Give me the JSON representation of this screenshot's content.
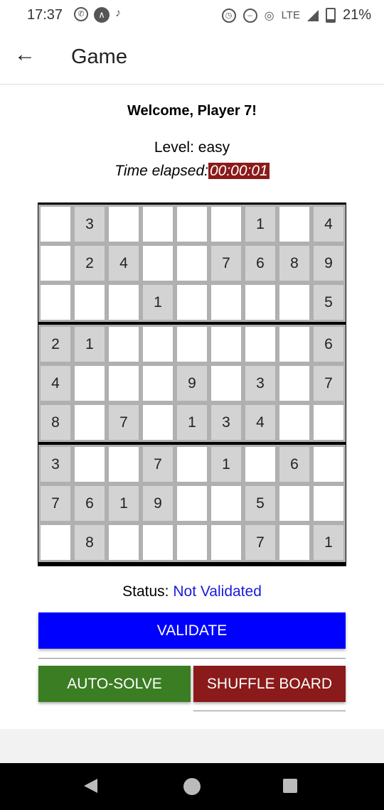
{
  "statusbar": {
    "time": "17:37",
    "lte": "LTE",
    "battery": "21%"
  },
  "appbar": {
    "title": "Game"
  },
  "welcome": "Welcome, Player 7!",
  "level": {
    "label": "Level:",
    "value": "easy"
  },
  "time_elapsed": {
    "label": "Time elapsed:",
    "value": "00:00:01"
  },
  "board": {
    "rows": [
      [
        "",
        "3",
        "",
        "",
        "",
        "",
        "1",
        "",
        "4"
      ],
      [
        "",
        "2",
        "4",
        "",
        "",
        "7",
        "6",
        "8",
        "9"
      ],
      [
        "",
        "",
        "",
        "1",
        "",
        "",
        "",
        "",
        "5"
      ],
      [
        "2",
        "1",
        "",
        "",
        "",
        "",
        "",
        "",
        "6"
      ],
      [
        "4",
        "",
        "",
        "",
        "9",
        "",
        "3",
        "",
        "7"
      ],
      [
        "8",
        "",
        "7",
        "",
        "1",
        "3",
        "4",
        "",
        ""
      ],
      [
        "3",
        "",
        "",
        "7",
        "",
        "1",
        "",
        "6",
        ""
      ],
      [
        "7",
        "6",
        "1",
        "9",
        "",
        "",
        "5",
        "",
        ""
      ],
      [
        "",
        "8",
        "",
        "",
        "",
        "",
        "7",
        "",
        "1"
      ]
    ],
    "given_cell_color": "#d3d3d3",
    "empty_cell_color": "#ffffff"
  },
  "status": {
    "label": "Status:",
    "value": "Not Validated",
    "value_color": "#1a1add"
  },
  "buttons": {
    "validate": "VALIDATE",
    "auto_solve": "AUTO-SOLVE",
    "shuffle": "SHUFFLE BOARD"
  },
  "colors": {
    "validate": "#0000ff",
    "auto_solve": "#3b7d23",
    "shuffle": "#8b1a1a",
    "timer": "#8b1a1a"
  }
}
